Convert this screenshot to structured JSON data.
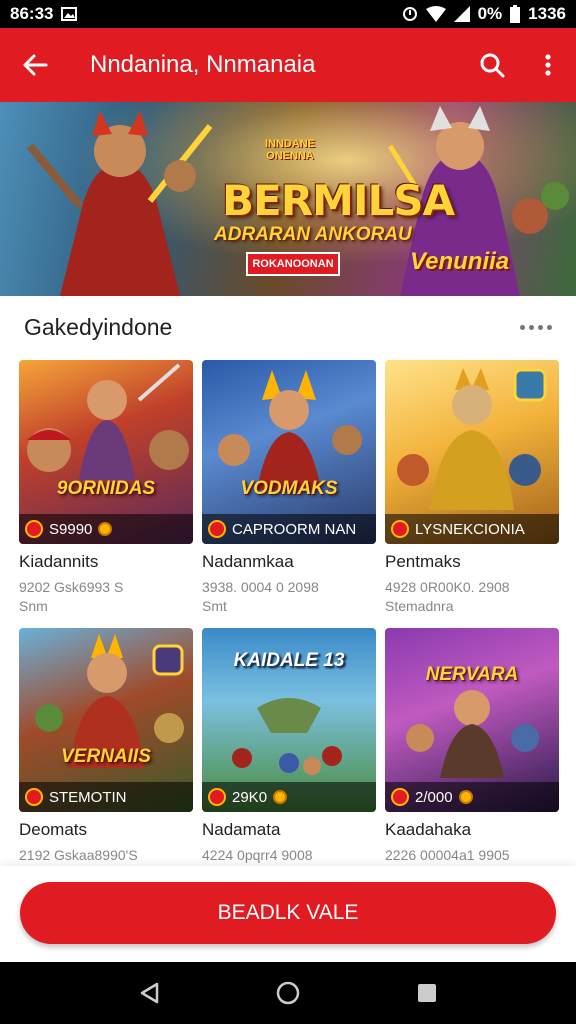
{
  "status_bar": {
    "time": "86:33",
    "battery": "0%",
    "clock_right": "1336"
  },
  "app_bar": {
    "title": "Nndanina, Nnmanaia"
  },
  "banner": {
    "small_title": "INNDANE ONENNA",
    "title": "BERMILSA",
    "subtitle": "ADRARAN ANKORAU",
    "cta": "ROKANOONAN",
    "brand": "Venuniia"
  },
  "section": {
    "title": "Gakedyindone"
  },
  "cards": [
    {
      "thumb_title": "9ORNIDAS",
      "price": "S9990",
      "name": "Kiadannits",
      "meta1": "9202 Gsk6993 S",
      "meta2": "Snm"
    },
    {
      "thumb_title": "VODMAKS",
      "price": "CAPROORM NAN",
      "name": "Nadanmkaa",
      "meta1": "3938. 0004 0 2098",
      "meta2": "Smt"
    },
    {
      "thumb_title": "",
      "price": "LYSNEKCIONIA",
      "name": "Pentmaks",
      "meta1": "4928 0R00K0. 2908",
      "meta2": "Stemadnra"
    },
    {
      "thumb_title": "VERNAIIS",
      "price": "STEMOTIN",
      "name": "Deomats",
      "meta1": "2192 Gskaa8990'S",
      "meta2": ""
    },
    {
      "thumb_title": "KAIDALE 13",
      "price": "29K0",
      "name": "Nadamata",
      "meta1": "4224 0pqrr4 9008",
      "meta2": ""
    },
    {
      "thumb_title": "NERVARA",
      "price": "2/000",
      "name": "Kaadahaka",
      "meta1": "2226 00004a1 9905",
      "meta2": ""
    }
  ],
  "primary_button": {
    "label": "BEADLK VALE"
  },
  "colors": {
    "accent": "#e01b22",
    "gold": "#ffd43a"
  }
}
